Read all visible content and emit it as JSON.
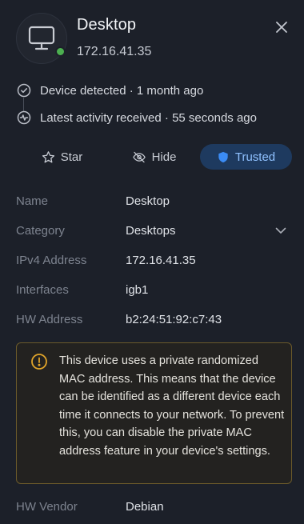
{
  "device": {
    "name": "Desktop",
    "ip": "172.16.41.35",
    "status": "online",
    "status_color": "#4caf50"
  },
  "icons": {
    "avatar": "monitor-icon",
    "close": "close-icon",
    "detected": "check-circle-icon",
    "activity": "activity-icon",
    "star": "star-icon",
    "hide": "eye-off-icon",
    "trusted": "shield-icon",
    "category": "chevron-down-icon",
    "warning": "alert-circle-icon"
  },
  "timeline": {
    "detected": "Device detected · 1 month ago",
    "activity": "Latest activity received · 55 seconds ago"
  },
  "actions": {
    "star": "Star",
    "hide": "Hide",
    "trusted": "Trusted",
    "trusted_active": true
  },
  "properties": {
    "name": {
      "label": "Name",
      "value": "Desktop"
    },
    "category": {
      "label": "Category",
      "value": "Desktops"
    },
    "ipv4": {
      "label": "IPv4 Address",
      "value": "172.16.41.35"
    },
    "interfaces": {
      "label": "Interfaces",
      "value": "igb1"
    },
    "hw_address": {
      "label": "HW Address",
      "value": "b2:24:51:92:c7:43"
    },
    "hw_vendor": {
      "label": "HW Vendor",
      "value": "Debian"
    }
  },
  "warning": {
    "text": "This device uses a private randomized MAC address. This means that the device can be identified as a different device each time it connects to your network. To prevent this, you can disable the private MAC address feature in your device's settings.",
    "accent_color": "#e0a42a"
  },
  "colors": {
    "background": "#1c2029",
    "accent": "#3b8cf5",
    "trusted_bg": "#1e3a5f"
  }
}
